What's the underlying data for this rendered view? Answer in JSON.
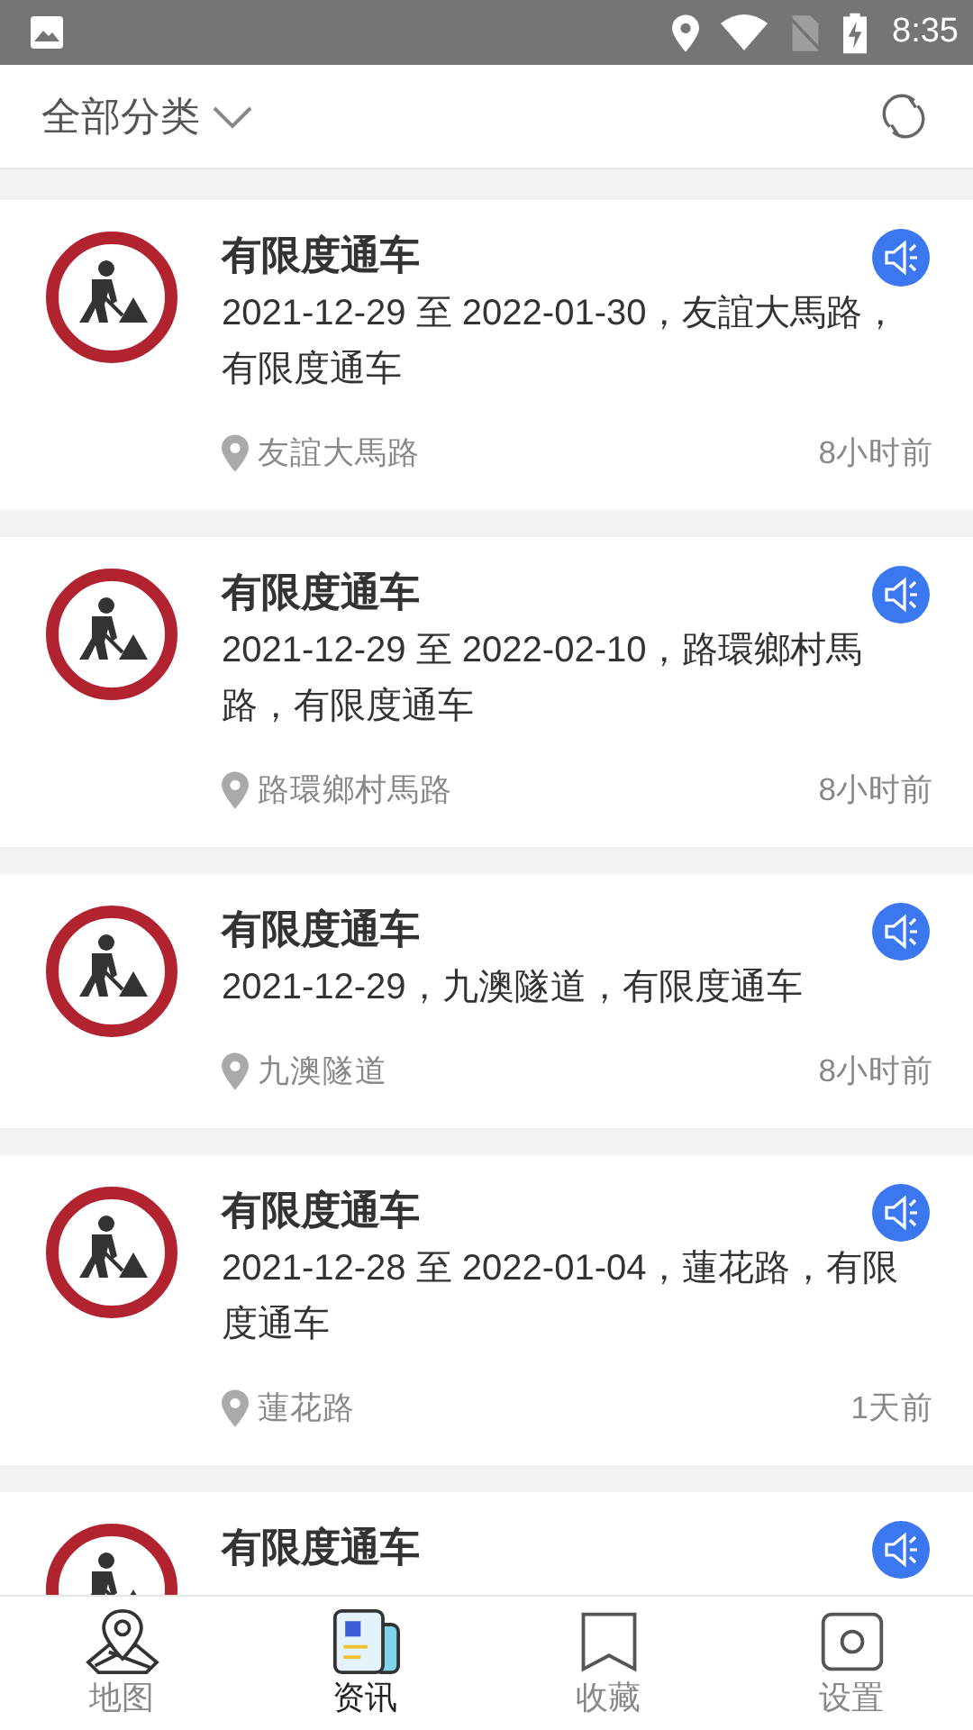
{
  "status_bar": {
    "time": "8:35"
  },
  "header": {
    "category": "全部分类"
  },
  "notices": [
    {
      "title": "有限度通车",
      "description": "2021-12-29 至 2022-01-30，友誼大馬路，有限度通车",
      "location": "友誼大馬路",
      "time": "8小时前"
    },
    {
      "title": "有限度通车",
      "description": "2021-12-29 至 2022-02-10，路環鄉村馬路，有限度通车",
      "location": "路環鄉村馬路",
      "time": "8小时前"
    },
    {
      "title": "有限度通车",
      "description": "2021-12-29，九澳隧道，有限度通车",
      "location": "九澳隧道",
      "time": "8小时前"
    },
    {
      "title": "有限度通车",
      "description": "2021-12-28 至 2022-01-04，蓮花路，有限度通车",
      "location": "蓮花路",
      "time": "1天前"
    },
    {
      "title": "有限度通车"
    }
  ],
  "tabs": [
    {
      "label": "地图",
      "kind": "map",
      "selected": false
    },
    {
      "label": "资讯",
      "kind": "news",
      "selected": true
    },
    {
      "label": "收藏",
      "kind": "bookmark",
      "selected": false
    },
    {
      "label": "设置",
      "kind": "settings",
      "selected": false
    }
  ]
}
